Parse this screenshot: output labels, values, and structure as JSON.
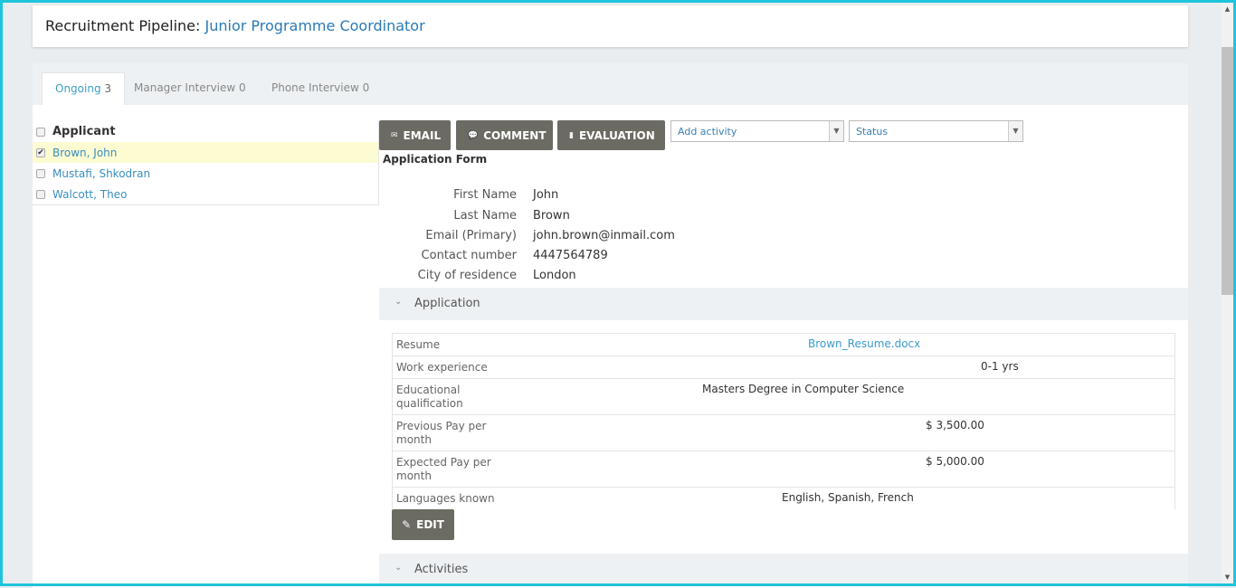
{
  "header": {
    "prefix": "Recruitment Pipeline:",
    "job_title": "Junior Programme Coordinator"
  },
  "tabs": [
    {
      "label": "Ongoing",
      "count": "3",
      "active": true
    },
    {
      "label": "Manager Interview",
      "count": "0",
      "active": false
    },
    {
      "label": "Phone Interview",
      "count": "0",
      "active": false
    }
  ],
  "applicants": {
    "header": "Applicant",
    "items": [
      {
        "name": "Brown, John",
        "checked": true
      },
      {
        "name": "Mustafi, Shkodran",
        "checked": false
      },
      {
        "name": "Walcott, Theo",
        "checked": false
      }
    ]
  },
  "toolbar": {
    "email_label": "EMAIL",
    "comment_label": "COMMENT",
    "evaluation_label": "EVALUATION",
    "activity_placeholder": "Add activity",
    "status_placeholder": "Status"
  },
  "form": {
    "title": "Application Form",
    "fields": [
      {
        "label": "First Name",
        "value": "John"
      },
      {
        "label": "Last Name",
        "value": "Brown"
      },
      {
        "label": "Email (Primary)",
        "value": "john.brown@inmail.com"
      },
      {
        "label": "Contact number",
        "value": "4447564789"
      },
      {
        "label": "City of residence",
        "value": "London"
      }
    ]
  },
  "application": {
    "title": "Application",
    "rows": [
      {
        "label": "Resume",
        "value": "Brown_Resume.docx"
      },
      {
        "label": "Work experience",
        "value": "0-1 yrs"
      },
      {
        "label": "Educational qualification",
        "value": "Masters Degree in Computer Science"
      },
      {
        "label": "Previous Pay per month",
        "value": "$ 3,500.00"
      },
      {
        "label": "Expected Pay per month",
        "value": "$ 5,000.00"
      },
      {
        "label": "Languages known",
        "value": "English, Spanish, French"
      }
    ],
    "edit_label": "EDIT"
  },
  "activities": {
    "title": "Activities"
  },
  "colors": {
    "accent": "#1ec3dc",
    "link": "#3a8fc0",
    "button": "#6b6b63",
    "selected_row": "#fdfbd2"
  },
  "icons": [
    "envelope-icon",
    "comment-icon",
    "evaluation-icon",
    "pencil-icon",
    "chevron-down-icon",
    "checkbox-icon"
  ]
}
